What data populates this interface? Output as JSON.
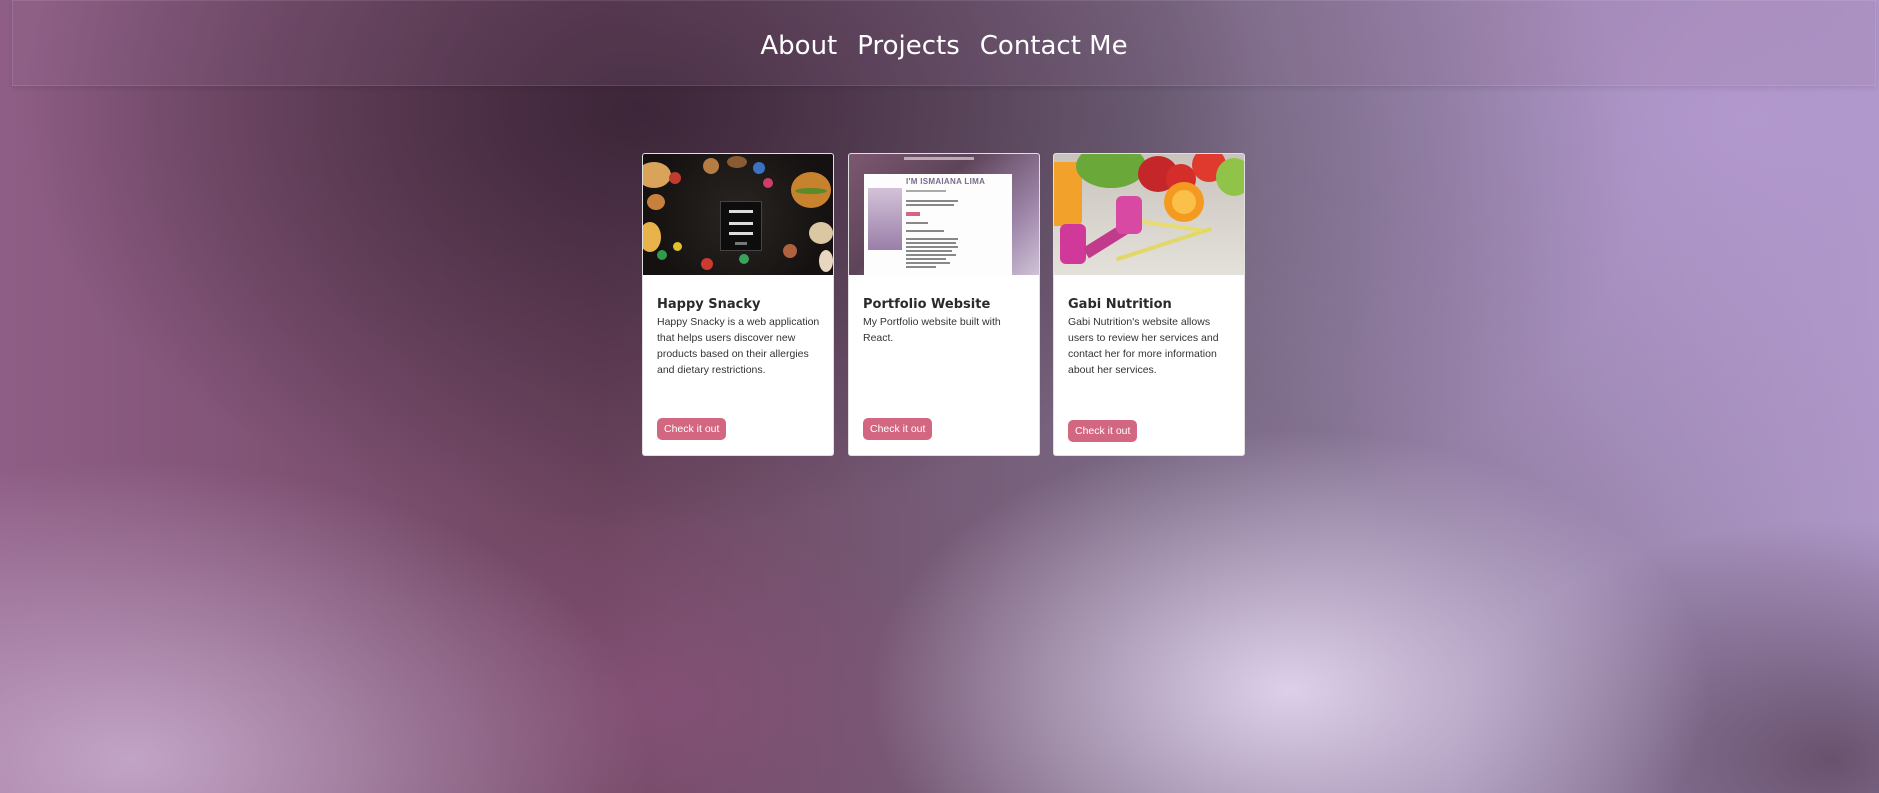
{
  "nav": {
    "links": [
      "About",
      "Projects",
      "Contact Me"
    ]
  },
  "projects": [
    {
      "title": "Happy Snacky",
      "description": "Happy Snacky is a web application that helps users discover new products based on their allergies and dietary restrictions.",
      "button": "Check it out",
      "image": "happy-snacky-screenshot"
    },
    {
      "title": "Portfolio Website",
      "description": "My Portfolio website built with React.",
      "button": "Check it out",
      "image": "portfolio-screenshot",
      "image_heading": "I'M ISMAIANA LIMA"
    },
    {
      "title": "Gabi Nutrition",
      "description": "Gabi Nutrition's website allows users to review her services and contact her for more information about her services.",
      "button": "Check it out",
      "image": "fruit-and-dumbbells-photo"
    }
  ],
  "colors": {
    "button": "#d36680",
    "card_background": "#ffffff",
    "nav_text": "#ffffff"
  }
}
